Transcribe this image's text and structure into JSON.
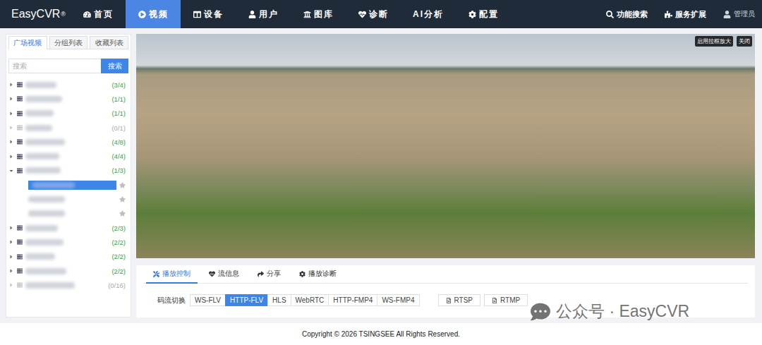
{
  "logo": {
    "name": "EasyCVR",
    "mark": "®"
  },
  "nav": [
    {
      "label": "首页",
      "selected": false
    },
    {
      "label": "视频",
      "selected": true
    },
    {
      "label": "设备",
      "selected": false
    },
    {
      "label": "用户",
      "selected": false
    },
    {
      "label": "图库",
      "selected": false
    },
    {
      "label": "诊断",
      "selected": false
    },
    {
      "label": "AI分析",
      "selected": false
    },
    {
      "label": "配置",
      "selected": false
    }
  ],
  "nav_right": [
    "功能搜索",
    "服务扩展"
  ],
  "user": "管理员",
  "sidebar": {
    "tabs": [
      {
        "label": "广场视频",
        "selected": true
      },
      {
        "label": "分组列表",
        "selected": false
      },
      {
        "label": "收藏列表",
        "selected": false
      }
    ],
    "search": {
      "placeholder": "搜索",
      "button": "搜索"
    },
    "tree": [
      {
        "count": "(3/4)",
        "online": true,
        "expanded": false,
        "children": []
      },
      {
        "count": "(1/1)",
        "online": true,
        "expanded": false,
        "children": []
      },
      {
        "count": "(1/1)",
        "online": true,
        "expanded": false,
        "children": []
      },
      {
        "count": "(0/1)",
        "online": false,
        "expanded": false,
        "children": []
      },
      {
        "count": "(4/8)",
        "online": true,
        "expanded": false,
        "children": []
      },
      {
        "count": "(4/4)",
        "online": true,
        "expanded": false,
        "children": []
      },
      {
        "count": "(1/3)",
        "online": true,
        "expanded": true,
        "children": [
          {
            "selected": true,
            "favorite": false
          },
          {
            "selected": false,
            "favorite": false
          },
          {
            "selected": false,
            "favorite": false
          }
        ]
      },
      {
        "count": "(2/3)",
        "online": true,
        "expanded": false,
        "children": []
      },
      {
        "count": "(2/2)",
        "online": true,
        "expanded": false,
        "children": []
      },
      {
        "count": "(2/2)",
        "online": true,
        "expanded": false,
        "children": []
      },
      {
        "count": "(2/2)",
        "online": true,
        "expanded": false,
        "children": []
      },
      {
        "count": "(0/16)",
        "online": false,
        "expanded": false,
        "children": []
      }
    ]
  },
  "video": {
    "overlay_buttons": [
      "启用拉框放大",
      "关闭"
    ]
  },
  "panel": {
    "tabs": [
      {
        "label": "播放控制",
        "selected": true
      },
      {
        "label": "流信息",
        "selected": false
      },
      {
        "label": "分享",
        "selected": false
      },
      {
        "label": "播放诊断",
        "selected": false
      }
    ],
    "stream_label": "码流切换",
    "streams": [
      {
        "label": "WS-FLV",
        "selected": false
      },
      {
        "label": "HTTP-FLV",
        "selected": true
      },
      {
        "label": "HLS",
        "selected": false
      },
      {
        "label": "WebRTC",
        "selected": false
      },
      {
        "label": "HTTP-FMP4",
        "selected": false
      },
      {
        "label": "WS-FMP4",
        "selected": false
      }
    ],
    "links": [
      "RTSP",
      "RTMP"
    ]
  },
  "footer": "Copyright © 2026 TSINGSEE All Rights Reserved.",
  "watermark": "公众号 · EasyCVR"
}
